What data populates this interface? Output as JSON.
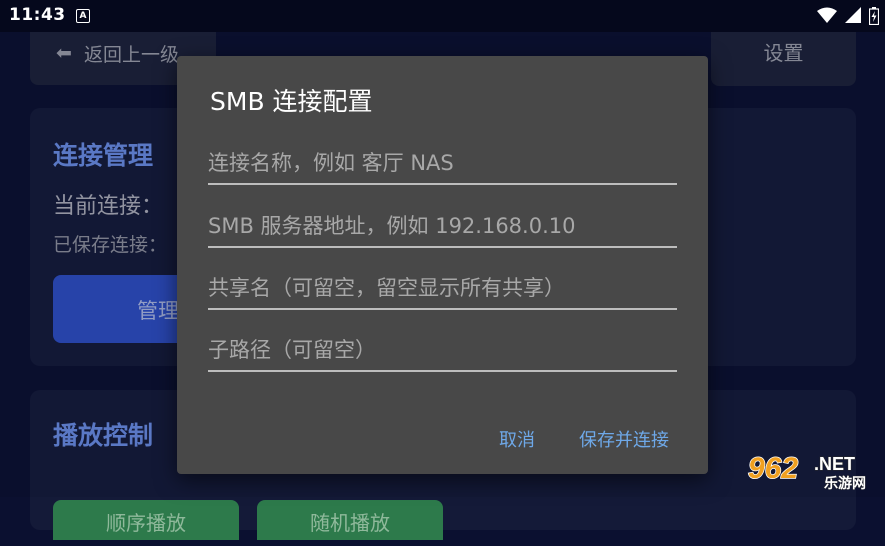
{
  "status_bar": {
    "time": "11:43",
    "notification_icon": "A"
  },
  "background": {
    "back_button": {
      "icon": "arrow-left-icon",
      "label": "返回上一级"
    },
    "settings_button": "设置",
    "connection_section": {
      "title": "连接管理",
      "current_connection": "当前连接：",
      "saved_connections": "已保存连接：",
      "manage_button": "管理"
    },
    "playback_section": {
      "title": "播放控制",
      "buttons": [
        "顺序播放",
        "随机播放"
      ]
    }
  },
  "dialog": {
    "title": "SMB 连接配置",
    "fields": [
      {
        "placeholder": "连接名称，例如 客厅 NAS",
        "value": ""
      },
      {
        "placeholder": "SMB 服务器地址，例如 192.168.0.10",
        "value": ""
      },
      {
        "placeholder": "共享名（可留空，留空显示所有共享）",
        "value": ""
      },
      {
        "placeholder": "子路径（可留空）",
        "value": ""
      }
    ],
    "cancel_label": "取消",
    "confirm_label": "保存并连接"
  },
  "watermark": {
    "number": "962",
    "suffix": ".NET",
    "sub": "乐游网"
  },
  "colors": {
    "accent": "#6ea8e8",
    "dialog_bg": "#484848",
    "app_bg": "#0b1030",
    "section_title": "#5f7fd0",
    "manage_button": "#2a47b3",
    "play_button": "#2d7a4b"
  }
}
